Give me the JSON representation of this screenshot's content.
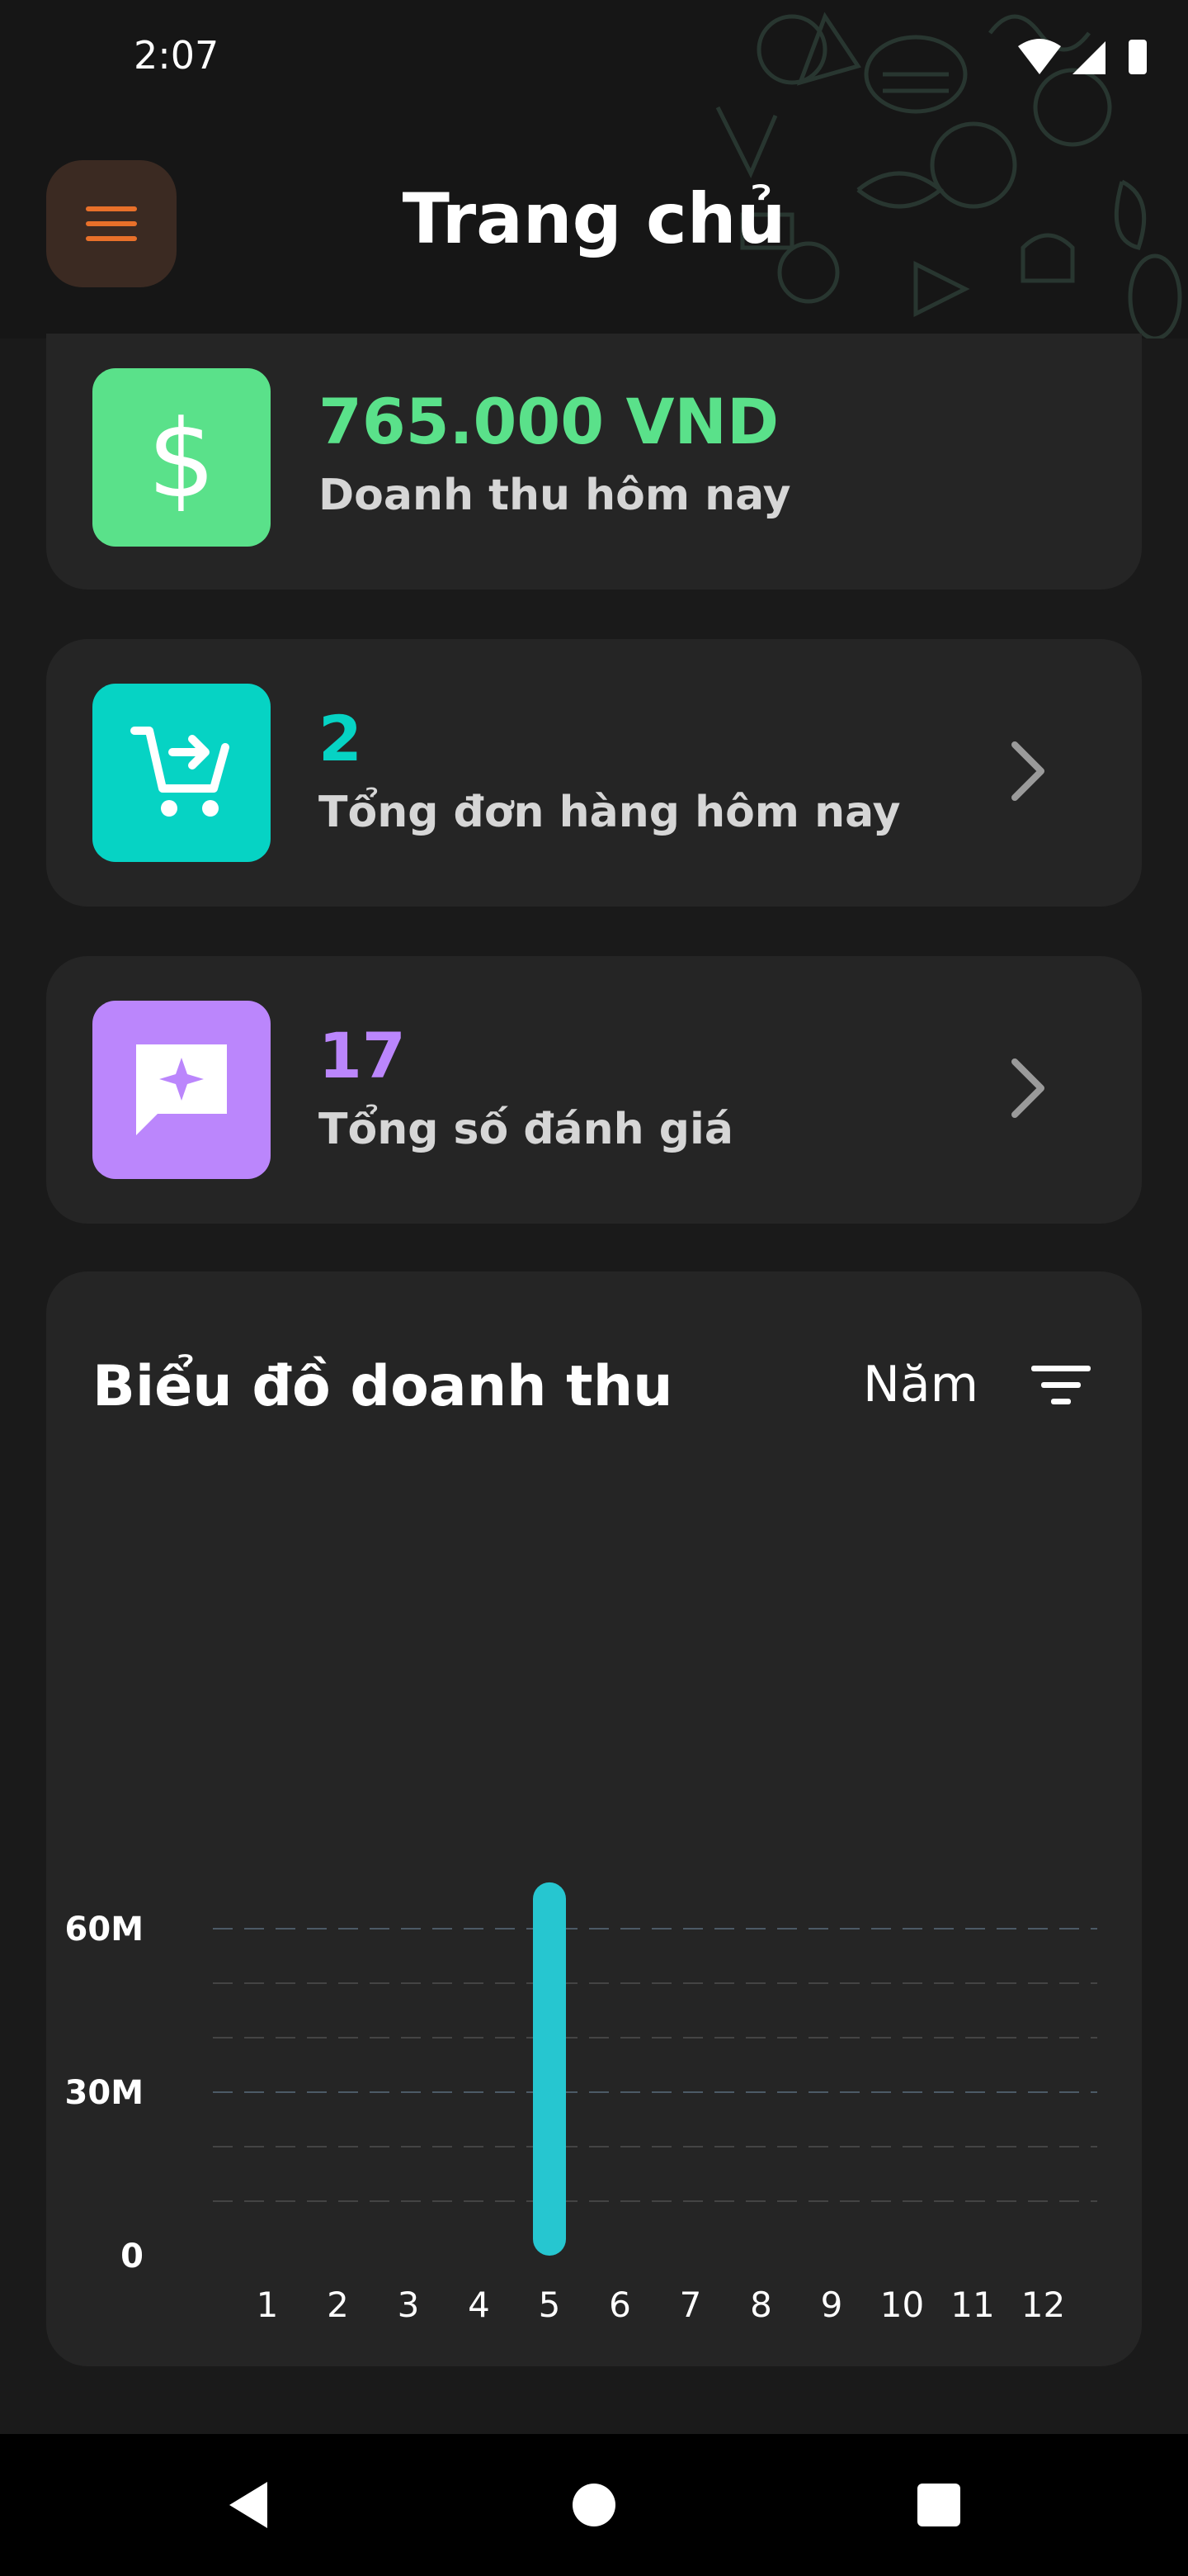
{
  "status_bar": {
    "time": "2:07"
  },
  "header": {
    "title": "Trang chủ"
  },
  "cards": [
    {
      "value": "765.000 VND",
      "label": "Doanh thu hôm nay",
      "color": "#5ae18a",
      "icon": "dollar-icon"
    },
    {
      "value": "2",
      "label": "Tổng đơn hàng hôm nay",
      "color": "#06d3c4",
      "icon": "cart-arrow-icon"
    },
    {
      "value": "17",
      "label": "Tổng số đánh giá",
      "color": "#bb86fc",
      "icon": "review-chat-icon"
    }
  ],
  "chart_section": {
    "title": "Biểu đồ doanh thu",
    "period": "Năm"
  },
  "chart_data": {
    "type": "bar",
    "categories": [
      "1",
      "2",
      "3",
      "4",
      "5",
      "6",
      "7",
      "8",
      "9",
      "10",
      "11",
      "12"
    ],
    "values": [
      0,
      0,
      0,
      0,
      68500000,
      0,
      0,
      0,
      0,
      0,
      0,
      0
    ],
    "ylim": [
      0,
      70000000
    ],
    "yticks": [
      0,
      30000000,
      60000000
    ],
    "ytick_labels": [
      "0",
      "30M",
      "60M"
    ],
    "grid": true,
    "bar_color": "#26c6d0"
  }
}
